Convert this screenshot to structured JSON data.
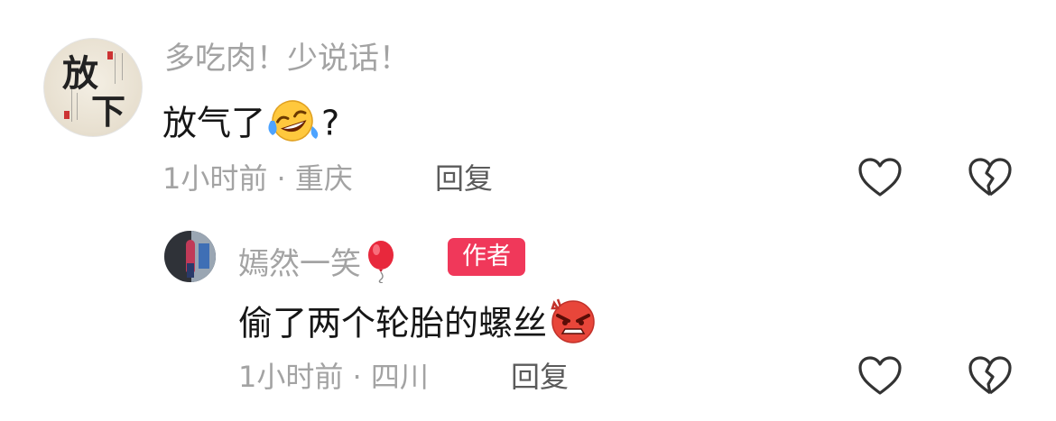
{
  "comments": [
    {
      "username": "多吃肉！少说话！",
      "avatar_lettering": "放下",
      "text_before_emoji": "放气了",
      "emoji": "rolling-on-floor-laughing-emoji",
      "text_after_emoji": "?",
      "time": "1小时前",
      "separator": "·",
      "location": "重庆",
      "reply_label": "回复"
    },
    {
      "username": "嫣然一笑",
      "username_emoji": "balloon-emoji",
      "author_badge": "作者",
      "text_before_emoji": "偷了两个轮胎的螺丝",
      "emoji": "angry-face-emoji",
      "time": "1小时前",
      "separator": "·",
      "location": "四川",
      "reply_label": "回复"
    }
  ],
  "colors": {
    "secondary_text": "#a3a3a3",
    "primary_text": "#161616",
    "reply_text": "#5b5b5b",
    "badge": "#f0385a",
    "icon_stroke": "#333333"
  },
  "icons": [
    "heart-icon",
    "broken-heart-icon"
  ]
}
